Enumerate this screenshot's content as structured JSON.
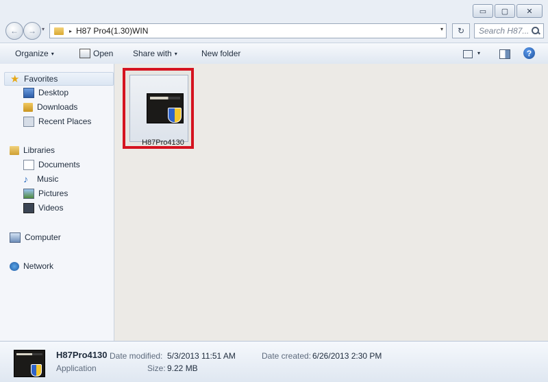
{
  "window": {
    "caption_buttons": [
      {
        "name": "minimize-button",
        "glyph": "▭"
      },
      {
        "name": "maximize-button",
        "glyph": "▢"
      },
      {
        "name": "close-button",
        "glyph": "✕"
      }
    ]
  },
  "address": {
    "back_glyph": "←",
    "forward_glyph": "→",
    "path": "H87 Pro4(1.30)WIN",
    "separator": "▸",
    "dropdown": "▾",
    "refresh_glyph": "↻",
    "search_placeholder": "Search H87..."
  },
  "toolbar": {
    "organize": "Organize",
    "open": "Open",
    "share_with": "Share with",
    "new_folder": "New folder",
    "caret": "▾",
    "help": "?"
  },
  "navpane": {
    "favorites": "Favorites",
    "desktop": "Desktop",
    "downloads": "Downloads",
    "recent_places": "Recent Places",
    "libraries": "Libraries",
    "documents": "Documents",
    "music": "Music",
    "pictures": "Pictures",
    "videos": "Videos",
    "computer": "Computer",
    "network": "Network",
    "star_glyph": "★",
    "note_glyph": "♪"
  },
  "content": {
    "file_name": "H87Pro4130"
  },
  "details": {
    "name": "H87Pro4130",
    "type": "Application",
    "date_modified_label": "Date modified:",
    "date_modified": "5/3/2013 11:51 AM",
    "size_label": "Size:",
    "size": "9.22 MB",
    "date_created_label": "Date created:",
    "date_created": "6/26/2013 2:30 PM"
  },
  "colors": {
    "highlight_border": "#d5131f"
  }
}
